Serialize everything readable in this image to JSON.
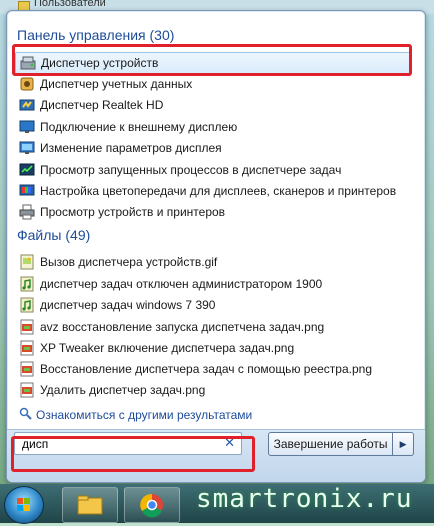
{
  "desktop": {
    "top_strip_text": "Пользователи"
  },
  "control_panel": {
    "header": "Панель управления (30)",
    "items": [
      {
        "label": "Диспетчер устройств",
        "icon": "device-manager-icon"
      },
      {
        "label": "Диспетчер учетных данных",
        "icon": "credential-manager-icon"
      },
      {
        "label": "Диспетчер Realtek HD",
        "icon": "realtek-audio-icon"
      },
      {
        "label": "Подключение к внешнему дисплею",
        "icon": "external-display-icon"
      },
      {
        "label": "Изменение параметров дисплея",
        "icon": "display-settings-icon"
      },
      {
        "label": "Просмотр запущенных процессов в диспетчере задач",
        "icon": "task-manager-icon"
      },
      {
        "label": "Настройка цветопередачи для дисплеев, сканеров и принтеров",
        "icon": "color-management-icon"
      },
      {
        "label": "Просмотр устройств и принтеров",
        "icon": "printer-icon"
      }
    ]
  },
  "files": {
    "header": "Файлы (49)",
    "items": [
      {
        "label": "Вызов диспетчера устройств.gif",
        "icon": "image-file-icon"
      },
      {
        "label": "диспетчер задач отключен администратором 1900",
        "icon": "audio-file-icon"
      },
      {
        "label": "диспетчер задач windows 7  390",
        "icon": "audio-file-icon"
      },
      {
        "label": "avz восстановление запуска диспетчена задач.png",
        "icon": "png-file-icon"
      },
      {
        "label": "XP Tweaker включение диспетчера задач.png",
        "icon": "png-file-icon"
      },
      {
        "label": "Восстановление диспетчера задач с помощью реестра.png",
        "icon": "png-file-icon"
      },
      {
        "label": "Удалить диспетчер задач.png",
        "icon": "png-file-icon"
      }
    ]
  },
  "more_results": "Ознакомиться с другими результатами",
  "search": {
    "value": "дисп",
    "clear_icon": "clear-icon"
  },
  "shutdown": {
    "label": "Завершение работы",
    "arrow_icon": "arrow-right-icon"
  },
  "taskbar": {
    "watermark": "smartronix.ru"
  },
  "colors": {
    "accent": "#1e4c9a",
    "highlight_border": "#e0212b",
    "selection": "#d9ecfb"
  }
}
